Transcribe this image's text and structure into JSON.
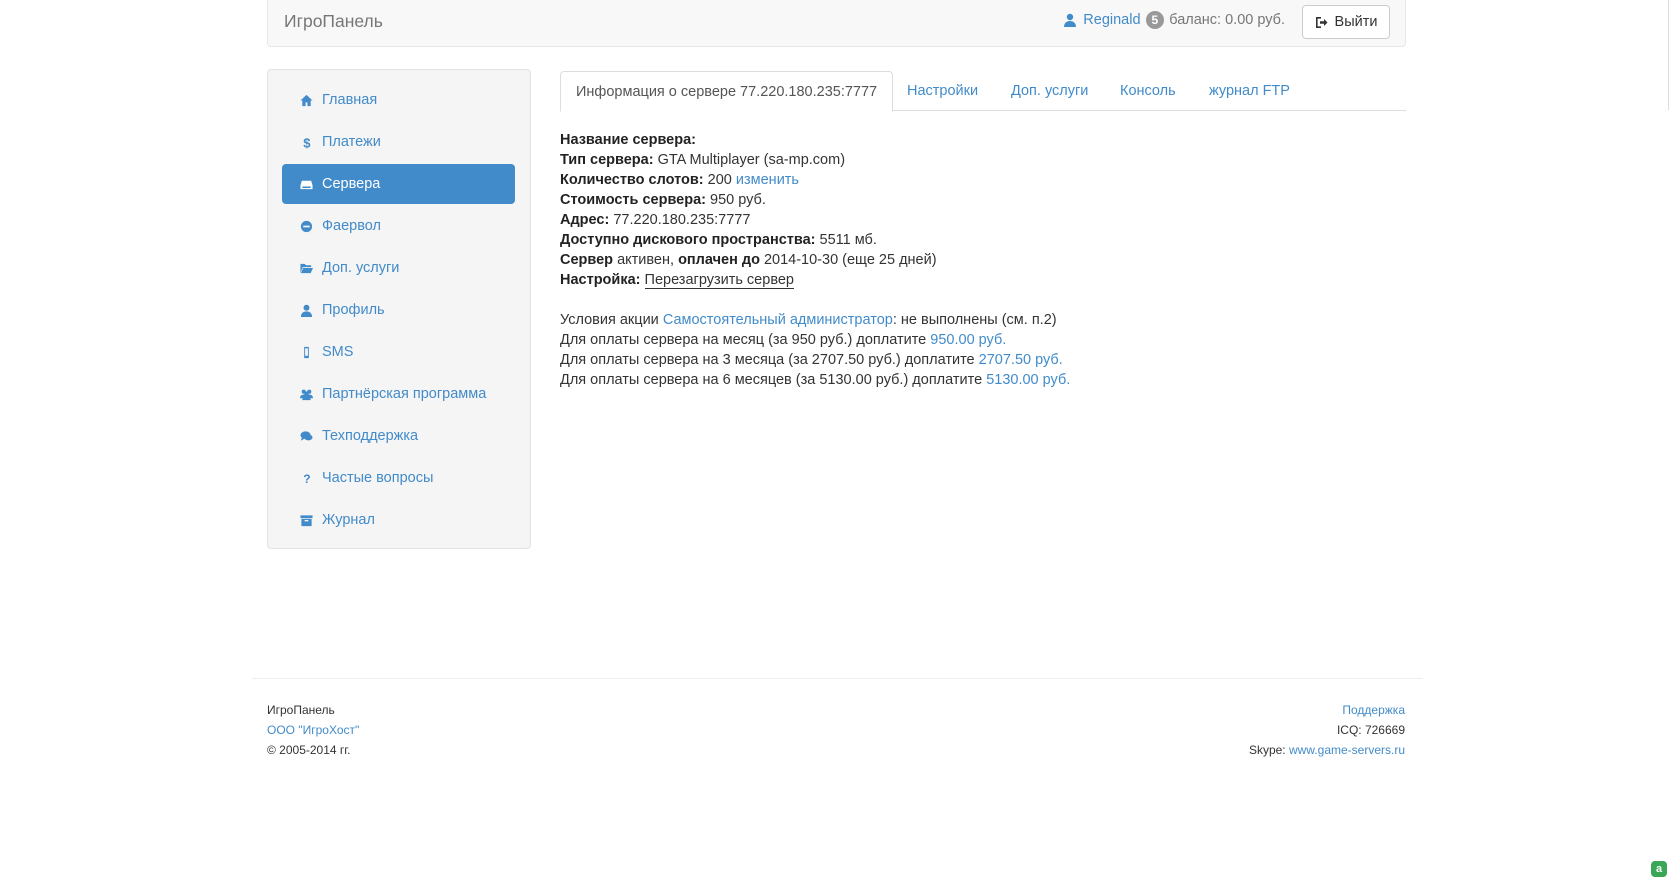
{
  "navbar": {
    "brand": "ИгроПанель",
    "username": "Reginald",
    "notifications": "5",
    "balance": "баланс: 0.00 руб.",
    "logout_label": "Выйти"
  },
  "sidebar": {
    "items": [
      {
        "label": "Главная",
        "icon": "home-icon"
      },
      {
        "label": "Платежи",
        "icon": "dollar-icon"
      },
      {
        "label": "Сервера",
        "icon": "hdd-icon",
        "active": true
      },
      {
        "label": "Фаервол",
        "icon": "minus-circle-icon"
      },
      {
        "label": "Доп. услуги",
        "icon": "folder-open-icon"
      },
      {
        "label": "Профиль",
        "icon": "user-icon"
      },
      {
        "label": "SMS",
        "icon": "mobile-icon"
      },
      {
        "label": "Партнёрская программа",
        "icon": "users-icon"
      },
      {
        "label": "Техподдержка",
        "icon": "comments-icon"
      },
      {
        "label": "Частые вопросы",
        "icon": "question-icon"
      },
      {
        "label": "Журнал",
        "icon": "archive-icon"
      }
    ]
  },
  "tabs": [
    {
      "label": "Информация о сервере 77.220.180.235:7777",
      "active": true
    },
    {
      "label": "Настройки"
    },
    {
      "label": "Доп. услуги"
    },
    {
      "label": "Консоль"
    },
    {
      "label": "журнал FTP"
    }
  ],
  "server": {
    "name_label": "Название сервера:",
    "name_value": "",
    "type_label": "Тип сервера:",
    "type_value": "GTA Multiplayer (sa-mp.com)",
    "slots_label": "Количество слотов:",
    "slots_value": "200",
    "slots_change": "изменить",
    "cost_label": "Стоимость сервера:",
    "cost_value": "950 руб.",
    "address_label": "Адрес:",
    "address_value": "77.220.180.235:7777",
    "disk_label": "Доступно дискового пространства:",
    "disk_value": "5511 мб.",
    "status_label": "Сервер",
    "status_value": "активен,",
    "paid_label": "оплачен до",
    "paid_value": "2014-10-30 (еще 25 дней)",
    "settings_label": "Настройка:",
    "restart_link": "Перезагрузить сервер"
  },
  "promo": {
    "conditions_prefix": "Условия акции",
    "conditions_link": "Самостоятельный администратор",
    "conditions_suffix": ": не выполнены (см. п.2)",
    "pay_lines": [
      {
        "text": "Для оплаты сервера на месяц (за 950 руб.) доплатите",
        "amount": "950.00 руб."
      },
      {
        "text": "Для оплаты сервера на 3 месяца (за 2707.50 руб.) доплатите",
        "amount": "2707.50 руб."
      },
      {
        "text": "Для оплаты сервера на 6 месяцев (за 5130.00 руб.) доплатите",
        "amount": "5130.00 руб."
      }
    ]
  },
  "footer": {
    "brand": "ИгроПанель",
    "company_link": "ООО \"ИгроХост\"",
    "copyright": "© 2005-2014 гг.",
    "support_link": "Поддержка",
    "icq": "ICQ: 726669",
    "skype_label": "Skype:",
    "skype_link": "www.game-servers.ru"
  },
  "colors": {
    "accent": "#428bca",
    "navbar_bg": "#f8f8f8",
    "sidebar_bg": "#f5f5f5"
  }
}
